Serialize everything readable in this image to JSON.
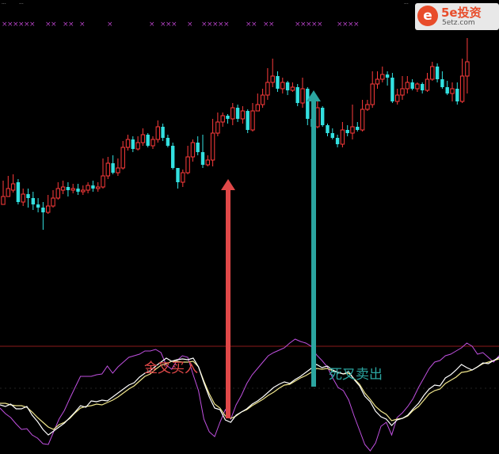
{
  "window": {
    "top_marks": [
      "...",
      "...",
      "...",
      "..."
    ]
  },
  "watermark": {
    "logo_icon": "coin-logo-icon",
    "logo_glyph": "e",
    "brand": "5e投资",
    "url": "5etz.com"
  },
  "signals": {
    "marker_char": "×",
    "marker_color": "#b040c0",
    "marker_groups": [
      {
        "start": 2,
        "count": 6
      },
      {
        "start": 57,
        "count": 2
      },
      {
        "start": 79,
        "count": 2
      },
      {
        "start": 100,
        "count": 1
      },
      {
        "start": 135,
        "count": 1
      },
      {
        "start": 188,
        "count": 1
      },
      {
        "start": 202,
        "count": 3
      },
      {
        "start": 236,
        "count": 1
      },
      {
        "start": 254,
        "count": 2
      },
      {
        "start": 268,
        "count": 3
      },
      {
        "start": 310,
        "count": 2
      },
      {
        "start": 332,
        "count": 2
      },
      {
        "start": 372,
        "count": 5
      },
      {
        "start": 425,
        "count": 4
      }
    ]
  },
  "annotations": {
    "buy_text": "金叉买入",
    "sell_text": "死叉卖出",
    "buy_color": "#e04848",
    "sell_color": "#2ba5a0"
  },
  "colors": {
    "background": "#000000",
    "up": "#ff3b3b",
    "down": "#33e0e0",
    "k_line": "#ffffff",
    "d_line": "#f0e68c",
    "j_line": "#c050e0",
    "divider": "#8b1a1a"
  },
  "chart_data": {
    "type": "candlestick",
    "price_candles": [
      [
        258,
        248,
        228,
        258
      ],
      [
        248,
        238,
        222,
        242
      ],
      [
        240,
        232,
        220,
        243
      ],
      [
        230,
        255,
        226,
        258
      ],
      [
        255,
        245,
        238,
        260
      ],
      [
        245,
        250,
        238,
        262
      ],
      [
        250,
        258,
        242,
        265
      ],
      [
        258,
        262,
        250,
        268
      ],
      [
        262,
        268,
        255,
        290
      ],
      [
        268,
        260,
        246,
        270
      ],
      [
        260,
        250,
        240,
        262
      ],
      [
        250,
        238,
        230,
        252
      ],
      [
        240,
        236,
        228,
        245
      ],
      [
        236,
        240,
        230,
        248
      ],
      [
        240,
        238,
        232,
        244
      ],
      [
        238,
        242,
        232,
        246
      ],
      [
        242,
        240,
        234,
        246
      ],
      [
        240,
        234,
        230,
        244
      ],
      [
        234,
        238,
        228,
        242
      ],
      [
        238,
        236,
        230,
        242
      ],
      [
        236,
        222,
        200,
        238
      ],
      [
        222,
        206,
        198,
        226
      ],
      [
        206,
        218,
        196,
        220
      ],
      [
        218,
        212,
        200,
        222
      ],
      [
        212,
        186,
        178,
        214
      ],
      [
        186,
        176,
        170,
        190
      ],
      [
        176,
        188,
        172,
        192
      ],
      [
        188,
        180,
        172,
        190
      ],
      [
        180,
        170,
        162,
        184
      ],
      [
        170,
        184,
        168,
        186
      ],
      [
        184,
        176,
        172,
        188
      ],
      [
        176,
        160,
        152,
        180
      ],
      [
        160,
        174,
        156,
        178
      ],
      [
        174,
        184,
        170,
        186
      ],
      [
        184,
        212,
        180,
        214
      ],
      [
        212,
        230,
        220,
        238
      ],
      [
        230,
        218,
        214,
        236
      ],
      [
        218,
        198,
        184,
        220
      ],
      [
        198,
        180,
        176,
        204
      ],
      [
        180,
        192,
        172,
        196
      ],
      [
        192,
        208,
        170,
        212
      ],
      [
        208,
        202,
        196,
        210
      ],
      [
        202,
        168,
        150,
        210
      ],
      [
        168,
        154,
        142,
        172
      ],
      [
        154,
        146,
        142,
        160
      ],
      [
        146,
        150,
        144,
        156
      ],
      [
        150,
        136,
        130,
        158
      ],
      [
        136,
        150,
        132,
        154
      ],
      [
        150,
        140,
        134,
        156
      ],
      [
        140,
        164,
        138,
        168
      ],
      [
        164,
        140,
        130,
        166
      ],
      [
        140,
        132,
        118,
        140
      ],
      [
        132,
        120,
        112,
        136
      ],
      [
        120,
        104,
        86,
        126
      ],
      [
        104,
        96,
        74,
        110
      ],
      [
        96,
        112,
        90,
        116
      ],
      [
        112,
        104,
        98,
        118
      ],
      [
        104,
        114,
        102,
        120
      ],
      [
        114,
        110,
        104,
        116
      ],
      [
        110,
        130,
        106,
        134
      ],
      [
        130,
        112,
        98,
        136
      ],
      [
        112,
        150,
        110,
        158
      ],
      [
        150,
        160,
        148,
        166
      ],
      [
        160,
        136,
        128,
        162
      ],
      [
        136,
        158,
        134,
        160
      ],
      [
        158,
        168,
        156,
        172
      ],
      [
        168,
        174,
        162,
        176
      ],
      [
        174,
        182,
        170,
        186
      ],
      [
        182,
        164,
        154,
        186
      ],
      [
        164,
        168,
        158,
        172
      ],
      [
        168,
        160,
        132,
        176
      ],
      [
        160,
        164,
        154,
        166
      ],
      [
        164,
        138,
        126,
        166
      ],
      [
        138,
        132,
        126,
        140
      ],
      [
        132,
        106,
        90,
        136
      ],
      [
        106,
        100,
        90,
        112
      ],
      [
        100,
        94,
        84,
        104
      ],
      [
        94,
        98,
        90,
        108
      ],
      [
        98,
        128,
        92,
        130
      ],
      [
        128,
        120,
        112,
        132
      ],
      [
        120,
        112,
        96,
        126
      ],
      [
        112,
        104,
        96,
        118
      ],
      [
        104,
        112,
        100,
        114
      ],
      [
        112,
        106,
        104,
        116
      ],
      [
        106,
        114,
        104,
        118
      ],
      [
        114,
        100,
        92,
        116
      ],
      [
        100,
        84,
        78,
        102
      ],
      [
        84,
        100,
        80,
        104
      ],
      [
        100,
        110,
        90,
        112
      ],
      [
        110,
        118,
        102,
        120
      ],
      [
        118,
        112,
        104,
        128
      ],
      [
        112,
        128,
        104,
        132
      ],
      [
        128,
        96,
        74,
        130
      ],
      [
        96,
        78,
        48,
        118
      ]
    ],
    "kdj": {
      "K": [
        62,
        60,
        63,
        57,
        57,
        60,
        49,
        41,
        31,
        24,
        29,
        34,
        39,
        46,
        53,
        61,
        59,
        67,
        66,
        68,
        67,
        72,
        77,
        82,
        87,
        90,
        97,
        102,
        105,
        111,
        116,
        121,
        117,
        119,
        120,
        119,
        121,
        110,
        90,
        72,
        58,
        56,
        43,
        40,
        49,
        53,
        57,
        63,
        67,
        72,
        78,
        84,
        88,
        91,
        89,
        94,
        98,
        103,
        108,
        113,
        109,
        111,
        106,
        103,
        101,
        104,
        94,
        86,
        73,
        66,
        54,
        47,
        44,
        36,
        43,
        45,
        49,
        57,
        64,
        74,
        82,
        87,
        86,
        96,
        100,
        106,
        113,
        109,
        106,
        110,
        115,
        114,
        118,
        122
      ],
      "D": [
        64,
        64,
        62,
        61,
        61,
        59,
        53,
        46,
        40,
        34,
        31,
        37,
        40,
        45,
        52,
        58,
        60,
        61,
        63,
        62,
        65,
        68,
        72,
        77,
        82,
        86,
        92,
        98,
        101,
        107,
        112,
        114,
        117,
        117,
        116,
        116,
        117,
        110,
        92,
        76,
        63,
        58,
        48,
        45,
        48,
        53,
        56,
        61,
        65,
        69,
        74,
        78,
        83,
        87,
        88,
        92,
        96,
        99,
        103,
        108,
        107,
        108,
        105,
        103,
        101,
        102,
        95,
        88,
        77,
        69,
        60,
        54,
        50,
        42,
        44,
        45,
        48,
        55,
        60,
        68,
        76,
        80,
        82,
        89,
        93,
        97,
        103,
        104,
        106,
        110,
        114,
        116,
        118,
        120
      ],
      "J": [
        58,
        51,
        46,
        38,
        31,
        32,
        24,
        20,
        13,
        12,
        28,
        44,
        55,
        70,
        84,
        98,
        98,
        98,
        100,
        101,
        111,
        102,
        110,
        116,
        122,
        124,
        126,
        130,
        130,
        132,
        128,
        112,
        107,
        118,
        124,
        122,
        100,
        80,
        44,
        28,
        22,
        40,
        56,
        44,
        62,
        74,
        89,
        100,
        108,
        116,
        124,
        128,
        131,
        134,
        140,
        145,
        142,
        140,
        136,
        125,
        118,
        110,
        96,
        84,
        80,
        68,
        48,
        30,
        12,
        4,
        14,
        35,
        40,
        24,
        46,
        52,
        60,
        70,
        84,
        96,
        108,
        116,
        118,
        124,
        126,
        130,
        134,
        140,
        136,
        126,
        128,
        122,
        116,
        124
      ]
    }
  }
}
